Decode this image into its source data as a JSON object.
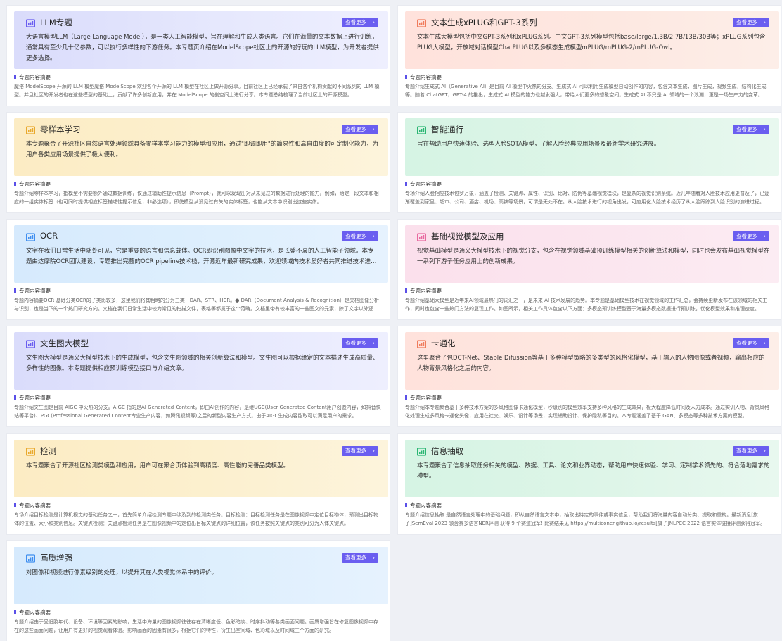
{
  "more_label": "查看更多",
  "summary_label": "专题内容摘要",
  "colors": {
    "button": "#6a5ef0",
    "icon_purple": "#6a5ef0",
    "icon_peach": "#f07c5c",
    "icon_yellow": "#e9a92d",
    "icon_green": "#2bb673",
    "icon_blue": "#3f8ef0",
    "icon_pink": "#e86aa0"
  },
  "cards": [
    {
      "title": "LLM专题",
      "icon": "chart-icon",
      "theme": "purple",
      "desc": "大语言模型LLM（Large Language Model），是一类人工智能模型，旨在理解和生成人类语言。它们在海量的文本数据上进行训练，通常具有至少几十亿参数，可以执行多样性的下游任务。本专题页介绍在ModelScope社区上的开源的好玩的LLM模型，为开发者提供更多选择。",
      "summary": "魔搭 ModelScope 开源的 LLM 模型魔搭 ModelScope 欢迎各个开源的 LLM 模型在社区上做开源分享。目前社区上已经承载了来自各个机构贡献的不同系列的 LLM 模型。并且社区的开发者也在这些模型的基础上，贡献了许多创新应用，并在 ModelScope 的创空间上进行分享。本专题总结梳理了当前社区上的开源模型。"
    },
    {
      "title": "文本生成xPLUG和GPT-3系列",
      "icon": "chart-icon",
      "theme": "peach",
      "desc": "文本生成大模型包括中文GPT-3系列和xPLUG系列。中文GPT-3系列模型包括base/large/1.3B/2.7B/13B/30B等；xPLUG系列包含PLUG大模型，开放域对话模型ChatPLUG以及多模态生成模型mPLUG/mPLUG-2/mPLUG-Owl。",
      "summary": "专题介绍生成式 AI（Generative AI）是目前 AI 模型中火热的分支。生成式 AI 可以利用生成模型自动创作的内容，包含文本生成，图片生成，视频生成，结构化生成等。随着 ChatGPT，GPT-4 的推出，生成式 AI 模型的能力也越发强大，带给人们更多的想象空间。生成式 AI 不只是 AI 领域的一个浪潮，更是一场生产力的变革。"
    },
    {
      "title": "零样本学习",
      "icon": "chart-icon",
      "theme": "yellow",
      "desc": "本专题聚合了开源社区自然语言处理领域具备零样本学习能力的模型和应用，通过\"即调即用\"的简易性和高自由度的可定制化能力，为用户各类应用场景提供了极大便利。",
      "summary": "专题介绍零样本学习，指模型不需要额外通过数据训练，仅通过辅助性提示信息（Prompt），就可以发现出对从未见过的数据进行处理的能力。例如，给定一段文本和相应的一组实体标签（也可同时提供相应标签描述性提示信息，非必选项），即使模型从没见过有关的实体标签，也能从文本中识别出这些实体。"
    },
    {
      "title": "智能通行",
      "icon": "chart-icon",
      "theme": "green",
      "desc": "旨在帮助用户快速体验、选型人脸SOTA模型，了解人脸经典应用场景及最新学术研究进展。",
      "summary": "专场介绍人脸相应技术包罗万象，涵盖了检测、关键点、属性、识别、比对、防伪等基础视觉模块，是复杂的视觉识别系统。近几年随着对人脸技术应用更普及了，已逐渐覆盖到家里、超市、公司、酒店、机场、高铁等场景，可谓是无处不在。从人脸技术进行的视角出发，可应用化人脸技术经历了从人脸跟踪到人脸识别的演进过程。"
    },
    {
      "title": "OCR",
      "icon": "chart-icon",
      "theme": "blue",
      "desc": "文字在我们日常生活中随处可见，它是重要的语言和信息载体。OCR即识别图像中文字的技术，是长盛不衰的人工智能子领域。本专题由达摩院OCR团队建设，专题推出完整的OCR pipeline技术栈，开源近年最新研究成果，欢迎领域内技术爱好者共同推进技术进步。",
      "summary": "专题内容摘要OCR 基础分类OCR的子类比较多，这里我们将其粗略的分为三类：DAR、STR、HCR。● DAR（Document Analysis & Recognition）是文档图像分析与识别，也是当下的一个热门研究方向。文档在我们日常生活中较为常见的扫描文件，表格等都属于这个范畴。文档里带有较丰富的一些图文的元素，除了文字以外还有表格和图片。"
    },
    {
      "title": "基础视觉模型及应用",
      "icon": "chart-icon",
      "theme": "pink",
      "desc": "视觉基础模型是通义大模型技术下的视觉分支，包含在视觉领域基础预训练模型相关的创新算法和模型，同时也会发布基础视觉模型在一系列下游子任务应用上的创新成果。",
      "summary": "专题介绍基础大模型是近年来AI领域最热门的词汇之一，是未来 AI 技术发展的趋势。本专题是基础模型技术在视觉领域的工作汇总，会持续更新发布在该领域的相关工作，同时也包含一些热门方法的复现工作。如图所示，相关工作具体包含以下方面：多模态预训练模型基于海量多模态数据进行预训练，优化模型效果和推理速度。"
    },
    {
      "title": "文生图大模型",
      "icon": "chart-icon",
      "theme": "purple",
      "desc": "文生图大模型是通义大模型技术下的生成模型，包含文生图领域的相关创新算法和模型。文生图可以根据给定的文本描述生成高质量、多样性的图像。本专题提供相应预训练模型接口与介绍文章。",
      "summary": "专题介绍文生图是目前 AIGC 中火热的分支。AIGC 指的是AI Generated Content，即由AI创作的内容，是继UGC(User Generated Content用户创造内容，如抖音快站等平台)、PGC(Professional Generated Content专业生产内容，如腾讯视频等)之后的新型内容生产方式。由于AIGC生成内容能取可以满足用户的需求。"
    },
    {
      "title": "卡通化",
      "icon": "chart-icon",
      "theme": "peach",
      "desc": "这里聚合了包DCT-Net、Stable Difussion等基于多种模型策略的多类型的风格化模型，基于输入的人物图像或者视频，输出相应的人物背景风格化之后的内容。",
      "summary": "专题介绍本专题聚合基于多种技术方案的多风格图像卡通化模型，秒级别的模型效率支持多种风格的生成效果，极大程度降低时间及人力成本。通过实训人物、背景风格化处理生成多风格卡通化头像，应用在社交、娱乐、设计等场景，实现辅助设计、保护隐私等目的。本专题涵盖了基于 GAN、多模态等多种技术方案的模型。"
    },
    {
      "title": "检测",
      "icon": "chart-icon",
      "theme": "yellow",
      "desc": "本专题聚合了开源社区检测类模型和应用，用户可在聚合页体验到高精度、高性能的完善品类模型。",
      "summary": "专场介绍目标检测是计算机视觉的基础任务之一，首先简单介绍检测专题中涉及到的检测类任务。目标检测：目标检测任务是在图像视频中定位目标物体，预测出目标物体的位置、大小和类别信息。关键点检测：关键点检测任务是在图像视频中的定位出目标关键点的详细位置，该任务按照关键点的类别可分为人体关键点。"
    },
    {
      "title": "信息抽取",
      "icon": "chart-icon",
      "theme": "green",
      "desc": "本专题聚合了信息抽取任务相关的模型、数据、工具、论文和业界动态，帮助用户快速体验、学习、定制学术领先的、符合落地需求的模型。",
      "summary": "专题介绍信息抽取 是自然语言处理中的基础问题，即从自然语言文本中，抽取出特定的事件或事实信息，帮助我们将海量内容自动分类、提取和重构。最新消息[旗子]SemEval 2023 领舍赛多语言NER评测 获得 9 个赛道冠军! 比赛结果见 https://multiconer.github.io/results[旗子]NLPCC 2022 语言实体链接评测获得冠军。"
    },
    {
      "title": "画质增强",
      "icon": "chart-icon",
      "theme": "blue",
      "desc": "对图像和视频进行像素级别的处理，以提升其在人类视觉体系中的评价。",
      "summary": "专题介绍由于受旧胶年代、设备、环境等因素的影响，生活中海量的图像视频往往存在清晰度低、色彩暗淡、时序抖动等各类画面问题。画质增强旨在修复图像视频中存在的这些画面问题，让用户有更好的视觉观看体验。影响画面的因素有很多，根据它们的特性，衍生出空间域、色彩域以及时间域三个方面的研究。"
    }
  ]
}
